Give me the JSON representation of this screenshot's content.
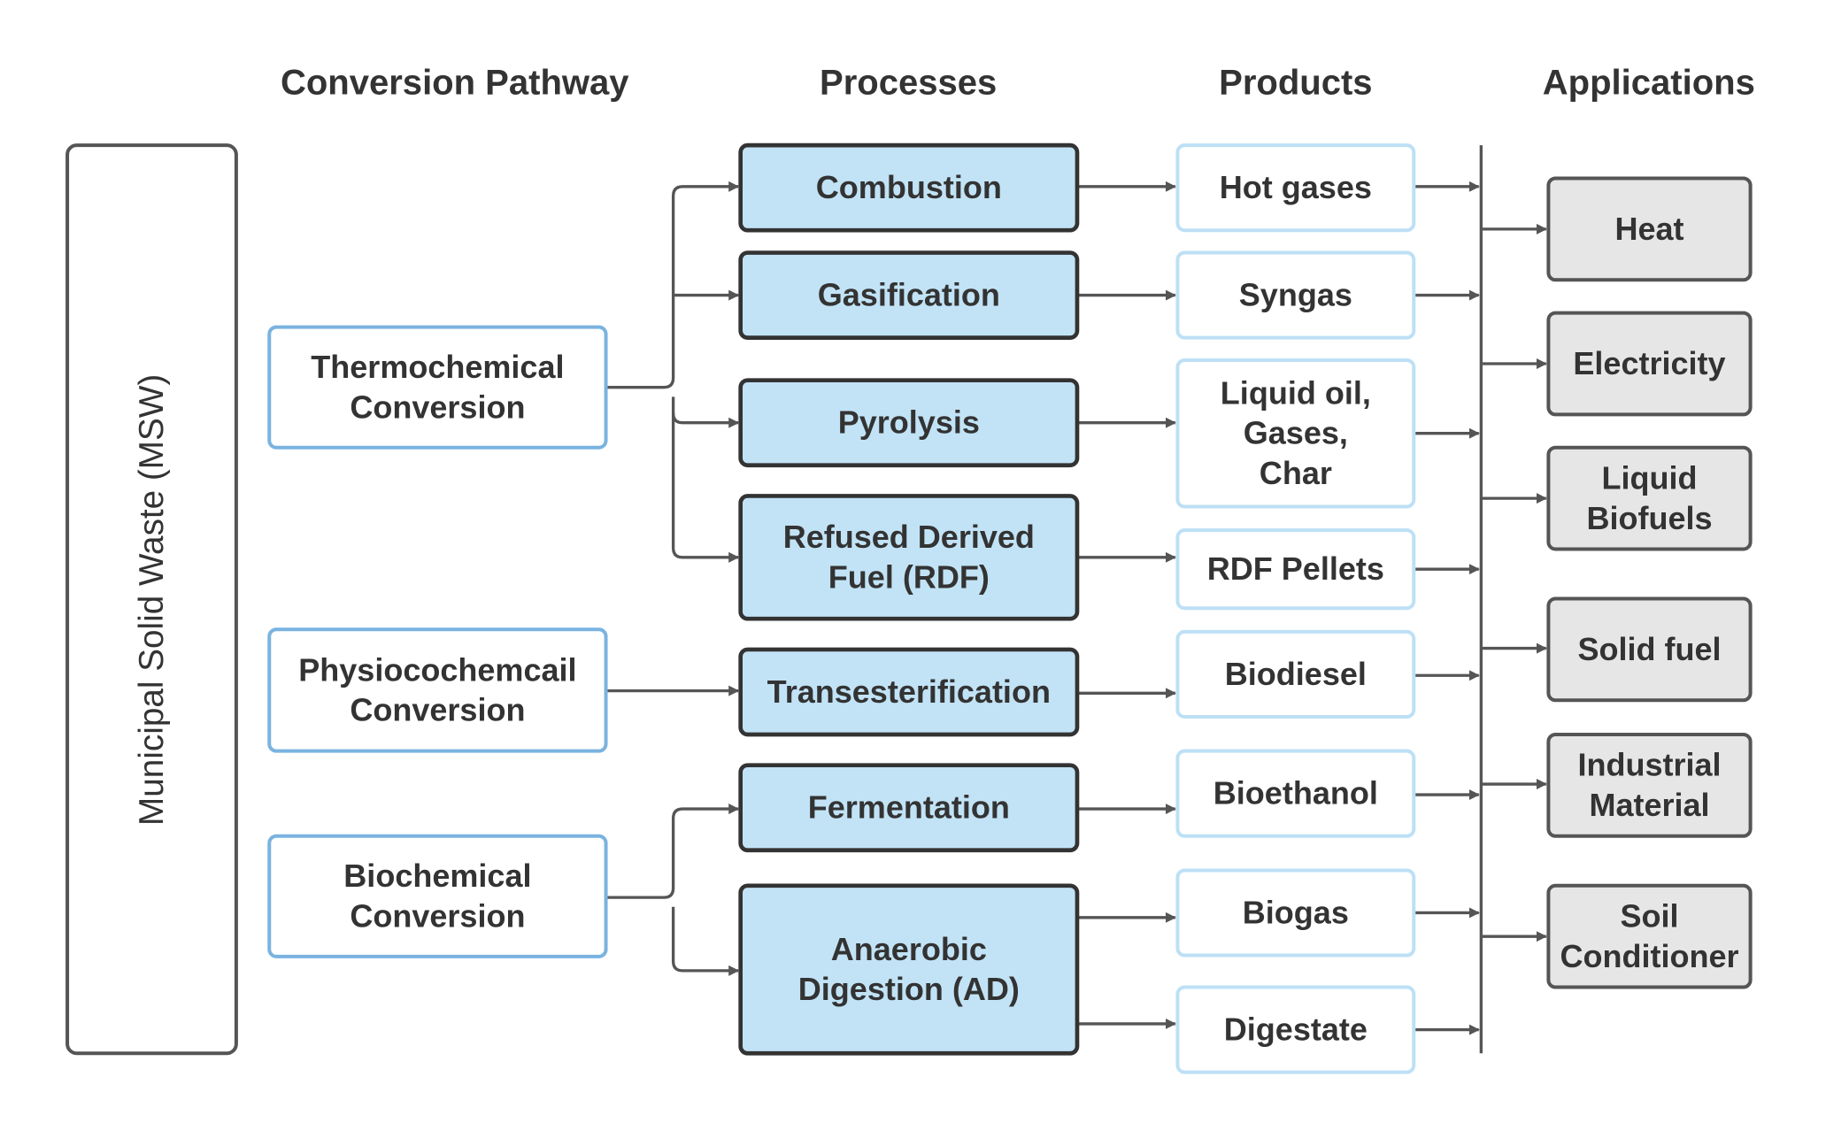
{
  "headers": [
    "Conversion Pathway",
    "Processes",
    "Products",
    "Applications"
  ],
  "source": "Municipal Solid Waste (MSW)",
  "pathways": [
    {
      "lines": [
        "Thermochemical",
        "Conversion"
      ]
    },
    {
      "lines": [
        "Physiocochemcail",
        "Conversion"
      ]
    },
    {
      "lines": [
        "Biochemical",
        "Conversion"
      ]
    }
  ],
  "processes": [
    {
      "lines": [
        "Combustion"
      ]
    },
    {
      "lines": [
        "Gasification"
      ]
    },
    {
      "lines": [
        "Pyrolysis"
      ]
    },
    {
      "lines": [
        "Refused Derived",
        "Fuel (RDF)"
      ]
    },
    {
      "lines": [
        "Transesterification"
      ]
    },
    {
      "lines": [
        "Fermentation"
      ]
    },
    {
      "lines": [
        "Anaerobic",
        "Digestion (AD)"
      ]
    }
  ],
  "products": [
    {
      "lines": [
        "Hot gases"
      ]
    },
    {
      "lines": [
        "Syngas"
      ]
    },
    {
      "lines": [
        "Liquid oil,",
        "Gases,",
        "Char"
      ]
    },
    {
      "lines": [
        "RDF Pellets"
      ]
    },
    {
      "lines": [
        "Biodiesel"
      ]
    },
    {
      "lines": [
        "Bioethanol"
      ]
    },
    {
      "lines": [
        "Biogas"
      ]
    },
    {
      "lines": [
        "Digestate"
      ]
    }
  ],
  "applications": [
    {
      "lines": [
        "Heat"
      ]
    },
    {
      "lines": [
        "Electricity"
      ]
    },
    {
      "lines": [
        "Liquid",
        "Biofuels"
      ]
    },
    {
      "lines": [
        "Solid fuel"
      ]
    },
    {
      "lines": [
        "Industrial",
        "Material"
      ]
    },
    {
      "lines": [
        "Soil",
        "Conditioner"
      ]
    }
  ],
  "colors": {
    "pathway_border": "#7ab3e0",
    "process_fill": "#c2e3f6",
    "process_border": "#333333",
    "product_border": "#bde0f5",
    "application_fill": "#e6e6e6",
    "application_border": "#555555",
    "connector": "#555555"
  }
}
